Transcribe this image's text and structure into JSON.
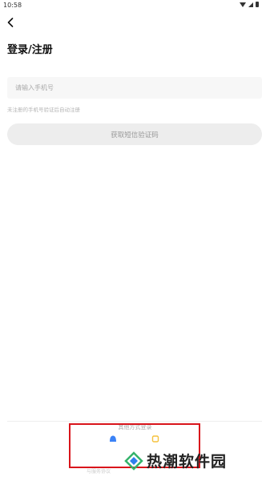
{
  "status_bar": {
    "time": "10:58"
  },
  "page": {
    "title": "登录/注册"
  },
  "phone": {
    "placeholder": "请输入手机号",
    "hint": "未注册的手机号验证后自动注册"
  },
  "sms_button": {
    "label": "获取短信验证码"
  },
  "other_login": {
    "label": "其他方式登录",
    "options": [
      {
        "icon": "bell-icon",
        "color": "#3b82f6"
      },
      {
        "icon": "square-icon",
        "color": "#f5c23d"
      }
    ],
    "agreement": "与服务协议"
  },
  "watermark": {
    "text": "热潮软件园"
  },
  "colors": {
    "highlight_box": "#d9141b",
    "watermark_green": "#35b36b",
    "watermark_blue": "#2f80ed"
  }
}
